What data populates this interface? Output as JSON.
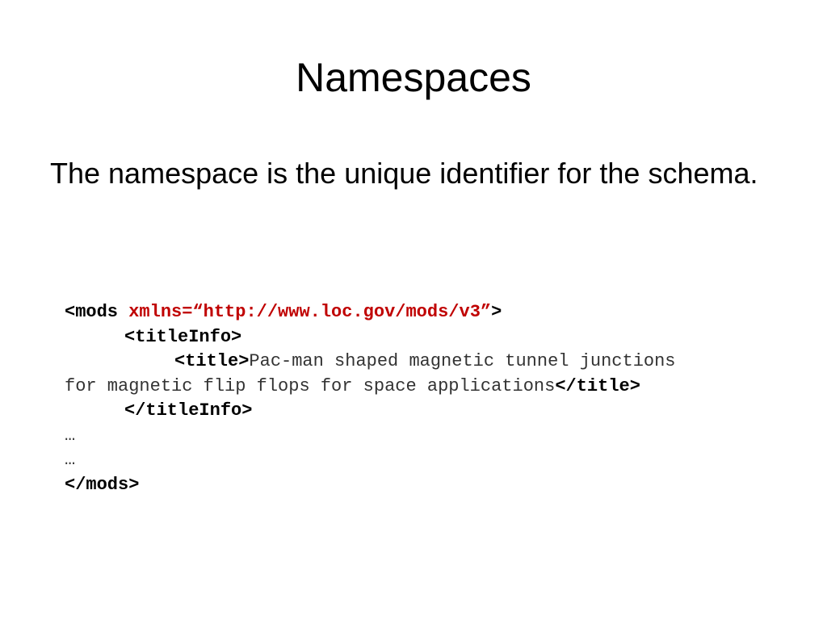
{
  "slide": {
    "title": "Namespaces",
    "body": "The namespace is the unique identifier for the schema.",
    "code": {
      "line1_tag_open": "<mods ",
      "line1_attr": "xmlns=“http://www.loc.gov/mods/v3”",
      "line1_tag_close": ">",
      "line2": "<titleInfo>",
      "line3_tag": "<title>",
      "line3_text": "Pac-man shaped magnetic tunnel junctions",
      "line4_text": "for magnetic flip flops for space applications",
      "line4_tag": "</title>",
      "line5": "</titleInfo>",
      "line6": "…",
      "line7": "…",
      "line8": "</mods>"
    },
    "colors": {
      "attribute": "#c00000",
      "text": "#000000"
    }
  }
}
